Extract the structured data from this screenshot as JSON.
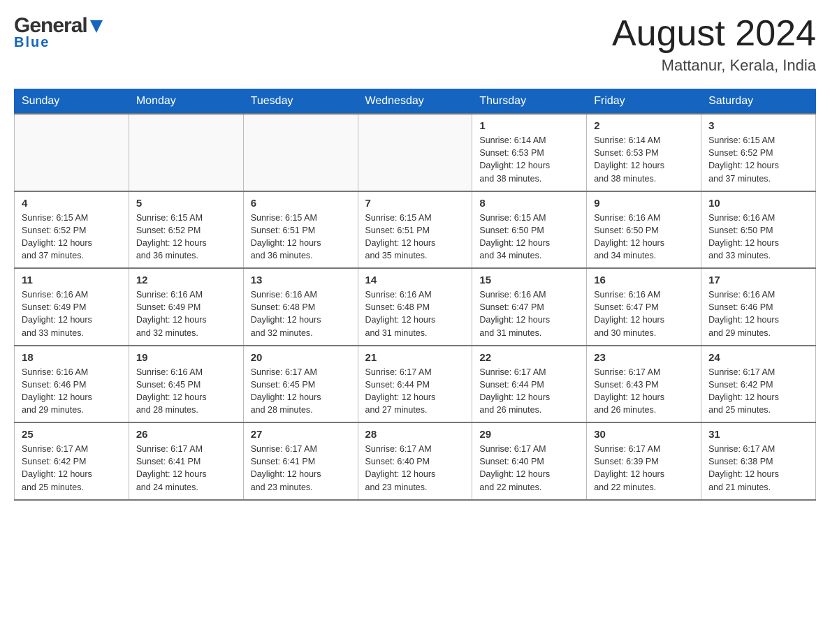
{
  "header": {
    "logo": {
      "general_text": "General",
      "blue_text": "Blue"
    },
    "title": "August 2024",
    "location": "Mattanur, Kerala, India"
  },
  "calendar": {
    "days_of_week": [
      "Sunday",
      "Monday",
      "Tuesday",
      "Wednesday",
      "Thursday",
      "Friday",
      "Saturday"
    ],
    "weeks": [
      [
        {
          "day": "",
          "info": ""
        },
        {
          "day": "",
          "info": ""
        },
        {
          "day": "",
          "info": ""
        },
        {
          "day": "",
          "info": ""
        },
        {
          "day": "1",
          "info": "Sunrise: 6:14 AM\nSunset: 6:53 PM\nDaylight: 12 hours\nand 38 minutes."
        },
        {
          "day": "2",
          "info": "Sunrise: 6:14 AM\nSunset: 6:53 PM\nDaylight: 12 hours\nand 38 minutes."
        },
        {
          "day": "3",
          "info": "Sunrise: 6:15 AM\nSunset: 6:52 PM\nDaylight: 12 hours\nand 37 minutes."
        }
      ],
      [
        {
          "day": "4",
          "info": "Sunrise: 6:15 AM\nSunset: 6:52 PM\nDaylight: 12 hours\nand 37 minutes."
        },
        {
          "day": "5",
          "info": "Sunrise: 6:15 AM\nSunset: 6:52 PM\nDaylight: 12 hours\nand 36 minutes."
        },
        {
          "day": "6",
          "info": "Sunrise: 6:15 AM\nSunset: 6:51 PM\nDaylight: 12 hours\nand 36 minutes."
        },
        {
          "day": "7",
          "info": "Sunrise: 6:15 AM\nSunset: 6:51 PM\nDaylight: 12 hours\nand 35 minutes."
        },
        {
          "day": "8",
          "info": "Sunrise: 6:15 AM\nSunset: 6:50 PM\nDaylight: 12 hours\nand 34 minutes."
        },
        {
          "day": "9",
          "info": "Sunrise: 6:16 AM\nSunset: 6:50 PM\nDaylight: 12 hours\nand 34 minutes."
        },
        {
          "day": "10",
          "info": "Sunrise: 6:16 AM\nSunset: 6:50 PM\nDaylight: 12 hours\nand 33 minutes."
        }
      ],
      [
        {
          "day": "11",
          "info": "Sunrise: 6:16 AM\nSunset: 6:49 PM\nDaylight: 12 hours\nand 33 minutes."
        },
        {
          "day": "12",
          "info": "Sunrise: 6:16 AM\nSunset: 6:49 PM\nDaylight: 12 hours\nand 32 minutes."
        },
        {
          "day": "13",
          "info": "Sunrise: 6:16 AM\nSunset: 6:48 PM\nDaylight: 12 hours\nand 32 minutes."
        },
        {
          "day": "14",
          "info": "Sunrise: 6:16 AM\nSunset: 6:48 PM\nDaylight: 12 hours\nand 31 minutes."
        },
        {
          "day": "15",
          "info": "Sunrise: 6:16 AM\nSunset: 6:47 PM\nDaylight: 12 hours\nand 31 minutes."
        },
        {
          "day": "16",
          "info": "Sunrise: 6:16 AM\nSunset: 6:47 PM\nDaylight: 12 hours\nand 30 minutes."
        },
        {
          "day": "17",
          "info": "Sunrise: 6:16 AM\nSunset: 6:46 PM\nDaylight: 12 hours\nand 29 minutes."
        }
      ],
      [
        {
          "day": "18",
          "info": "Sunrise: 6:16 AM\nSunset: 6:46 PM\nDaylight: 12 hours\nand 29 minutes."
        },
        {
          "day": "19",
          "info": "Sunrise: 6:16 AM\nSunset: 6:45 PM\nDaylight: 12 hours\nand 28 minutes."
        },
        {
          "day": "20",
          "info": "Sunrise: 6:17 AM\nSunset: 6:45 PM\nDaylight: 12 hours\nand 28 minutes."
        },
        {
          "day": "21",
          "info": "Sunrise: 6:17 AM\nSunset: 6:44 PM\nDaylight: 12 hours\nand 27 minutes."
        },
        {
          "day": "22",
          "info": "Sunrise: 6:17 AM\nSunset: 6:44 PM\nDaylight: 12 hours\nand 26 minutes."
        },
        {
          "day": "23",
          "info": "Sunrise: 6:17 AM\nSunset: 6:43 PM\nDaylight: 12 hours\nand 26 minutes."
        },
        {
          "day": "24",
          "info": "Sunrise: 6:17 AM\nSunset: 6:42 PM\nDaylight: 12 hours\nand 25 minutes."
        }
      ],
      [
        {
          "day": "25",
          "info": "Sunrise: 6:17 AM\nSunset: 6:42 PM\nDaylight: 12 hours\nand 25 minutes."
        },
        {
          "day": "26",
          "info": "Sunrise: 6:17 AM\nSunset: 6:41 PM\nDaylight: 12 hours\nand 24 minutes."
        },
        {
          "day": "27",
          "info": "Sunrise: 6:17 AM\nSunset: 6:41 PM\nDaylight: 12 hours\nand 23 minutes."
        },
        {
          "day": "28",
          "info": "Sunrise: 6:17 AM\nSunset: 6:40 PM\nDaylight: 12 hours\nand 23 minutes."
        },
        {
          "day": "29",
          "info": "Sunrise: 6:17 AM\nSunset: 6:40 PM\nDaylight: 12 hours\nand 22 minutes."
        },
        {
          "day": "30",
          "info": "Sunrise: 6:17 AM\nSunset: 6:39 PM\nDaylight: 12 hours\nand 22 minutes."
        },
        {
          "day": "31",
          "info": "Sunrise: 6:17 AM\nSunset: 6:38 PM\nDaylight: 12 hours\nand 21 minutes."
        }
      ]
    ]
  }
}
